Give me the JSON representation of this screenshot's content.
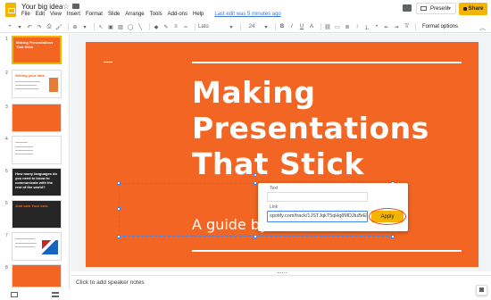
{
  "app": {
    "doc_title": "Your big idea",
    "menus": [
      "File",
      "Edit",
      "View",
      "Insert",
      "Format",
      "Slide",
      "Arrange",
      "Tools",
      "Add-ons",
      "Help"
    ],
    "last_edit": "Last edit was 5 minutes ago",
    "present_label": "Present",
    "share_label": "Share",
    "accent_color": "#f4b400"
  },
  "toolbar": {
    "font": "Lato",
    "size": "24",
    "format_options": "Format options"
  },
  "filmstrip": {
    "slides": [
      {
        "num": "1",
        "text": "Making Presentations That Stick"
      },
      {
        "num": "2",
        "text": "Writing your idea"
      },
      {
        "num": "3",
        "text": ""
      },
      {
        "num": "4",
        "text": ""
      },
      {
        "num": "5",
        "text": "How many languages do you need to know to communicate with the rest of the world?"
      },
      {
        "num": "6",
        "text": "Just own Your own."
      },
      {
        "num": "7",
        "text": ""
      },
      {
        "num": "8",
        "text": ""
      },
      {
        "num": "9",
        "text": ""
      }
    ]
  },
  "slide": {
    "title": "Making Presentations That Stick",
    "subtitle": "A guide by",
    "background": "#f26522"
  },
  "link_popup": {
    "text_label": "Text",
    "link_label": "Link",
    "link_value": "spotify.com/track/1JSTJqkT5qHq8MDJtuBrEl",
    "apply_label": "Apply"
  },
  "notes": {
    "placeholder": "Click to add speaker notes"
  }
}
